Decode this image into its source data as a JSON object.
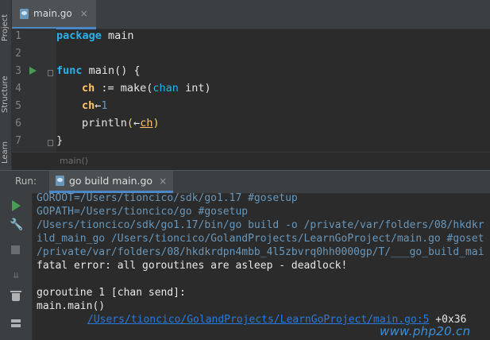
{
  "side_tabs": {
    "project": "Project",
    "structure": "Structure",
    "learn": "Learn"
  },
  "editor": {
    "tab": {
      "label": "main.go",
      "close": "×"
    },
    "line_numbers": [
      "1",
      "2",
      "3",
      "4",
      "5",
      "6",
      "7"
    ],
    "lines": {
      "l1_kw": "package",
      "l1_rest": " main",
      "l3_kw": "func",
      "l3_rest": " main() {",
      "l4_var": "ch",
      "l4_a": " := make(",
      "l4_kw": "chan",
      "l4_b": " int)",
      "l5_var": "ch",
      "l5_op": "←",
      "l5_num": "1",
      "l6_a": "println",
      "l6_p1": "(",
      "l6_op": "←",
      "l6_var": "ch",
      "l6_p2": ")",
      "l7": "}"
    },
    "breadcrumb": "main()"
  },
  "run_window": {
    "label": "Run:",
    "tab": {
      "label": "go build main.go",
      "close": "×"
    },
    "console": {
      "line1": "GOROOT=/Users/tioncico/sdk/go1.17 #gosetup",
      "line2": "GOPATH=/Users/tioncico/go #gosetup",
      "line3": "/Users/tioncico/sdk/go1.17/bin/go build -o /private/var/folders/08/hkdkr",
      "line4": "ild_main_go /Users/tioncico/GolandProjects/LearnGoProject/main.go #goset",
      "line5": "/private/var/folders/08/hkdkrdpn4mbb_4l5zbvrq0hh0000gp/T/___go_build_mai",
      "line6": "fatal error: all goroutines are asleep - deadlock!",
      "line8": "goroutine 1 [chan send]:",
      "line9": "main.main()",
      "line10_link": "/Users/tioncico/GolandProjects/LearnGoProject/main.go:5",
      "line10_rest": " +0x36"
    }
  },
  "watermark": "www.php20.cn",
  "colors": {
    "keyword": "#2bb0e8",
    "variable": "#ffc66d",
    "path": "#6897bb",
    "run_green": "#499c54",
    "accent": "#4a88c7"
  }
}
